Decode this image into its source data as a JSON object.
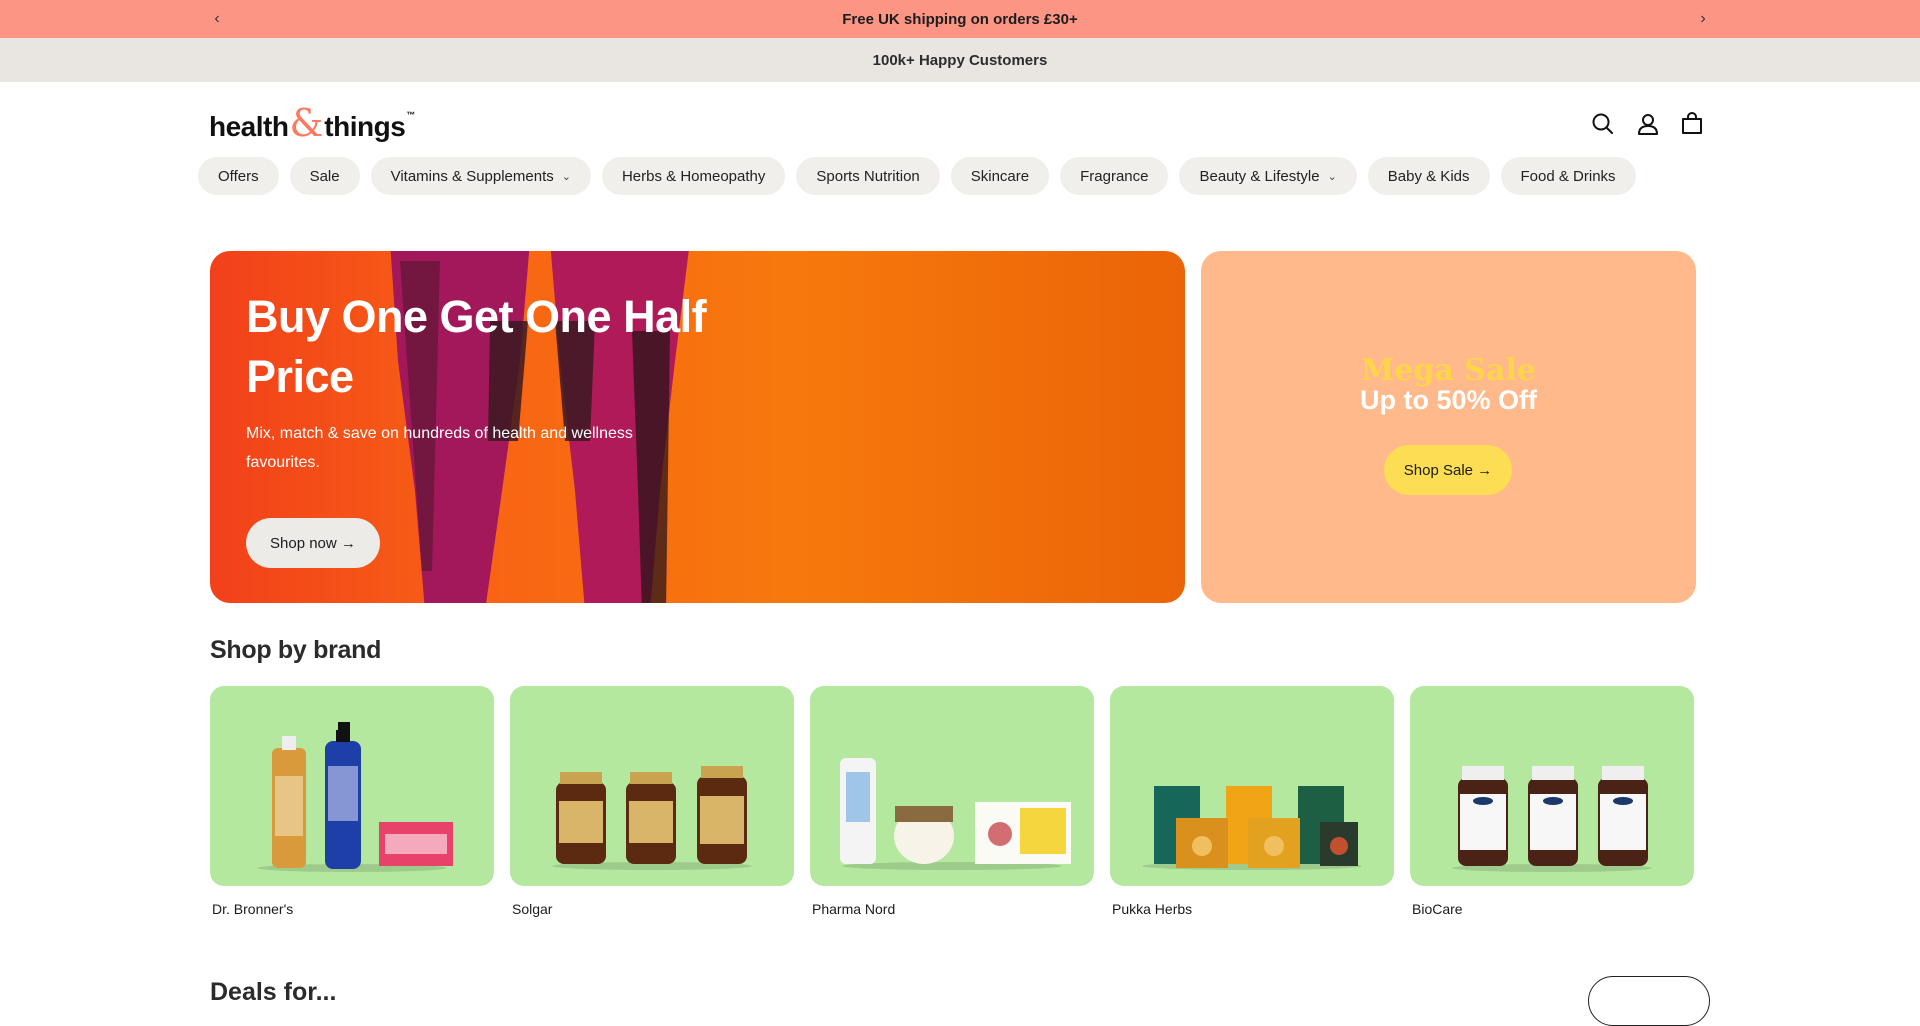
{
  "announcement": {
    "text": "Free UK shipping on orders £30+",
    "prev_icon": "chevron-left-icon",
    "next_icon": "chevron-right-icon"
  },
  "subbar": {
    "text": "100k+ Happy Customers"
  },
  "logo": {
    "word1": "health",
    "amp": "&",
    "word2": "things",
    "tm": "™"
  },
  "header_icons": [
    "search-icon",
    "account-icon",
    "cart-icon"
  ],
  "nav": {
    "items": [
      {
        "label": "Offers",
        "dropdown": false
      },
      {
        "label": "Sale",
        "dropdown": false
      },
      {
        "label": "Vitamins & Supplements",
        "dropdown": true
      },
      {
        "label": "Herbs & Homeopathy",
        "dropdown": false
      },
      {
        "label": "Sports Nutrition",
        "dropdown": false
      },
      {
        "label": "Skincare",
        "dropdown": false
      },
      {
        "label": "Fragrance",
        "dropdown": false
      },
      {
        "label": "Beauty & Lifestyle",
        "dropdown": true
      },
      {
        "label": "Baby & Kids",
        "dropdown": false
      },
      {
        "label": "Food & Drinks",
        "dropdown": false
      }
    ]
  },
  "hero": {
    "title": "Buy One Get One Half Price",
    "subtitle": "Mix, match & save on hundreds of health and wellness favourites.",
    "cta": "Shop now →"
  },
  "promo": {
    "title": "Mega Sale",
    "subtitle": "Up to 50% Off",
    "cta": "Shop Sale →"
  },
  "brands": {
    "title": "Shop by brand",
    "items": [
      {
        "name": "Dr. Bronner's"
      },
      {
        "name": "Solgar"
      },
      {
        "name": "Pharma Nord"
      },
      {
        "name": "Pukka Herbs"
      },
      {
        "name": "BioCare"
      }
    ]
  },
  "next_section": {
    "title": "Deals for..."
  },
  "colors": {
    "announcement_bg": "#fd9585",
    "subbar_bg": "#e9e6e1",
    "brand_card_bg": "#b4e89f",
    "promo_bg": "#ffb98a",
    "promo_cta_bg": "#fcdd53",
    "accent": "#fd7a62"
  }
}
